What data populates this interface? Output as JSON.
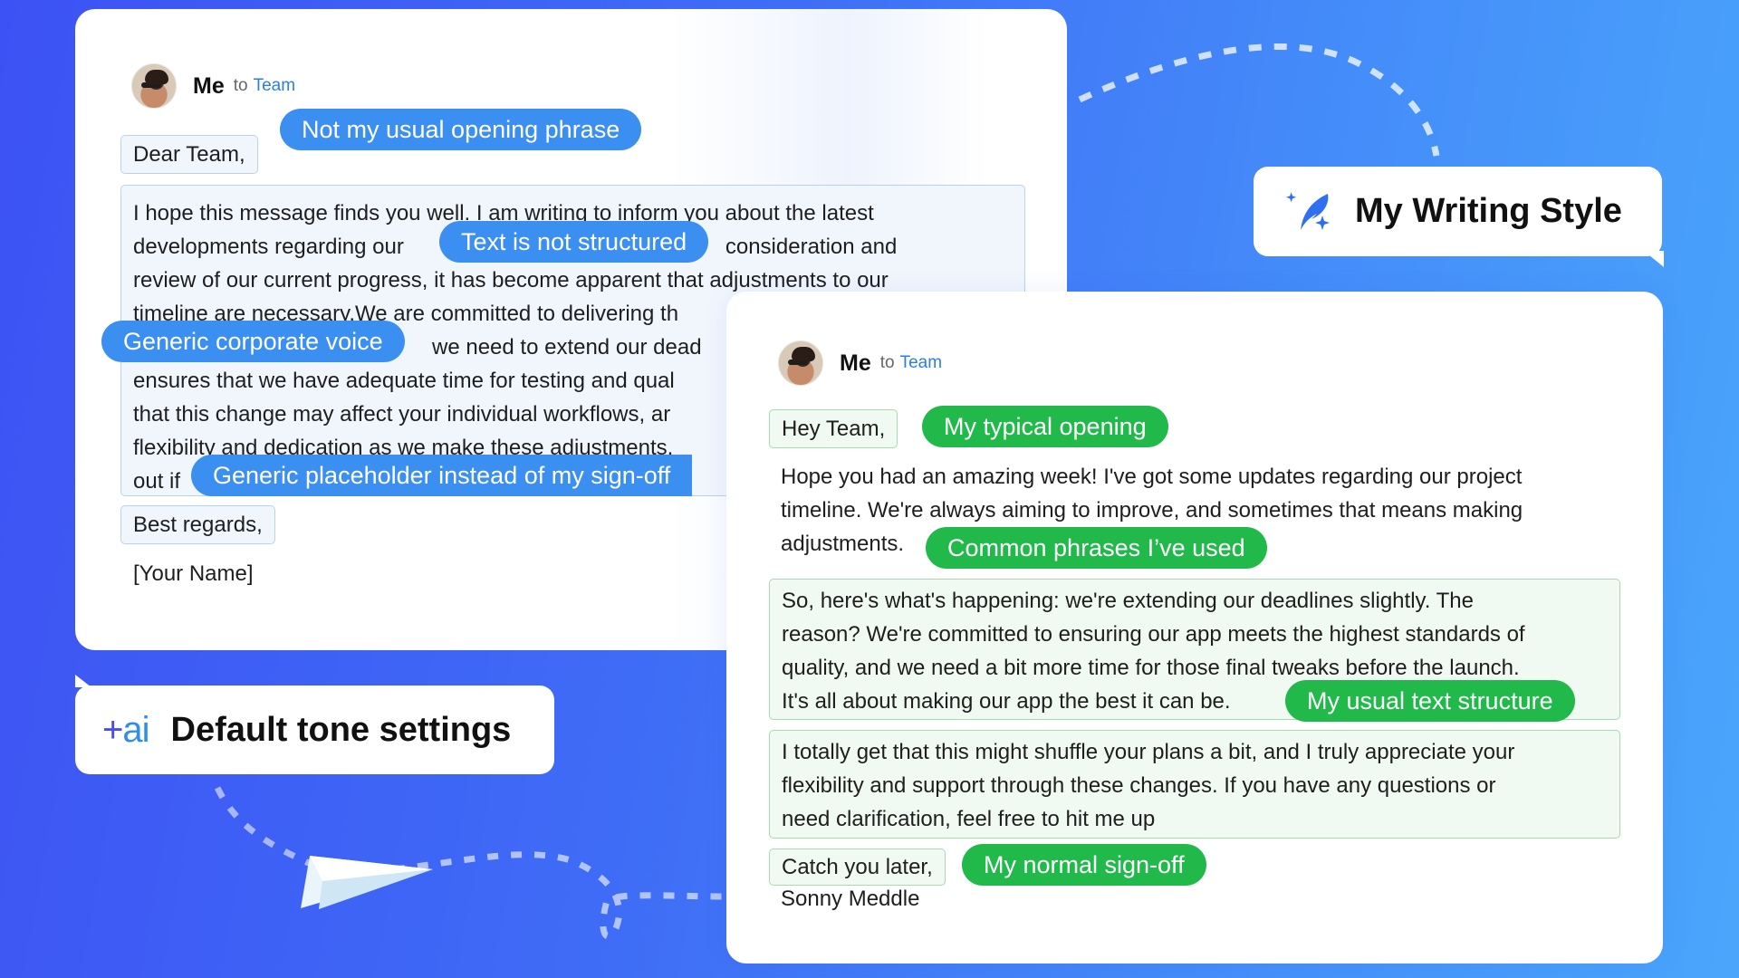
{
  "colors": {
    "critique_pill": "#3b8ff0",
    "style_pill": "#21b94a",
    "team_link": "#2b7fe0"
  },
  "left_email": {
    "sender": "Me",
    "to_label": "to",
    "recipient": "Team",
    "greeting": "Dear Team,",
    "body_lines": [
      "I hope this message finds you well. I am writing to inform you about the latest",
      "developments regarding our",
      "consideration and",
      "review of our current progress, it has become apparent that adjustments to our",
      "timeline are necessary.We are committed to delivering th",
      "we need to extend our dead",
      "ensures that we have adequate time for testing and qual",
      "that this change may affect your individual workflows, ar",
      "flexibility and dedication as we make these adjustments.",
      "out if"
    ],
    "closing": "Best regards,",
    "signature": "[Your Name]",
    "annotations": {
      "opening": "Not my usual opening phrase",
      "structure": "Text is not structured",
      "voice": "Generic corporate voice",
      "signoff": "Generic placeholder instead of my sign-off"
    }
  },
  "right_email": {
    "sender": "Me",
    "to_label": "to",
    "recipient": "Team",
    "greeting": "Hey Team,",
    "intro_lines": [
      "Hope you had an amazing week! I've got some updates regarding our project",
      "timeline. We're always aiming to improve, and sometimes that means making",
      "adjustments."
    ],
    "paragraph1_lines": [
      "So, here's what's happening: we're extending our deadlines slightly. The",
      "reason? We're committed to ensuring our app meets the highest standards of",
      "quality, and we need a bit more time for those final tweaks before the launch.",
      "It's all about making our app the best it can be."
    ],
    "paragraph2_lines": [
      "I totally get that this might shuffle your plans a bit, and I truly appreciate your",
      "flexibility and support through these changes. If you have any questions or",
      "need clarification, feel free to hit me up"
    ],
    "closing": "Catch you later,",
    "signature": "Sonny Meddle",
    "annotations": {
      "opening": "My typical opening",
      "phrases": "Common phrases I’ve used",
      "structure": "My usual text structure",
      "signoff": "My normal sign-off"
    }
  },
  "badges": {
    "writing_style": {
      "title": "My Writing Style",
      "icon": "feather-sparkle-icon"
    },
    "default_tone": {
      "title": "Default tone settings",
      "logo_plus": "+",
      "logo_ai": "ai",
      "icon": "plus-ai-logo"
    }
  }
}
